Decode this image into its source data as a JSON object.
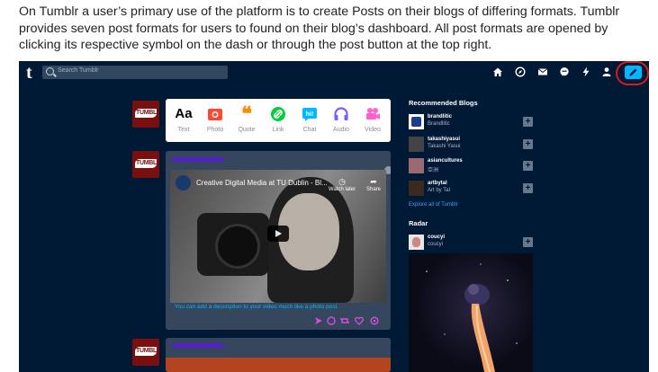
{
  "caption": "On Tumblr a user’s primary use of the platform is to create Posts on their blogs of differing formats. Tumblr provides seven post formats for users to found on their blog’s dashboard. All post formats are opened by clicking its respective symbol on the dash or through the post button at the top right.",
  "tumblr": {
    "logo": "t",
    "search_placeholder": "Search Tumblr",
    "nav_icons": [
      "home-icon",
      "explore-icon",
      "inbox-icon",
      "messages-icon",
      "activity-icon",
      "account-icon"
    ],
    "post_button_icon": "pencil-icon",
    "avatar_text": "TUMBLR",
    "post_formats": [
      {
        "label": "Text",
        "glyph": "Aa",
        "color": "#000000"
      },
      {
        "label": "Photo",
        "glyph": "◙",
        "color": "#ff492f"
      },
      {
        "label": "Quote",
        "glyph": "❝",
        "color": "#ff8a00"
      },
      {
        "label": "Link",
        "glyph": "🔗",
        "color": "#00cf35"
      },
      {
        "label": "Chat",
        "glyph": "hi!",
        "color": "#00b8ff"
      },
      {
        "label": "Audio",
        "glyph": "🎧",
        "color": "#7c5cff"
      },
      {
        "label": "Video",
        "glyph": "🎥",
        "color": "#ff62ce"
      }
    ],
    "video_post": {
      "video_title": "Creative Digital Media at TU Dublin - Bl...",
      "watch_later": "Watch later",
      "share": "Share",
      "description": "You can add a description to your video much like a photo post"
    },
    "recommended": {
      "title": "Recommended Blogs",
      "blogs": [
        {
          "name": "brandlitic",
          "sub": "Brandlitic",
          "color": "#1a3e8c"
        },
        {
          "name": "takashiyasui",
          "sub": "Takashi Yasui",
          "color": "#444444"
        },
        {
          "name": "asiancultures",
          "sub": "亞洲",
          "color": "#9a6a70"
        },
        {
          "name": "artbytal",
          "sub": "Art by Tal",
          "color": "#3a2a20"
        }
      ],
      "explore": "Explore all of Tumblr"
    },
    "radar": {
      "title": "Radar",
      "blog_name": "coucyi",
      "blog_sub": "coucyi"
    },
    "colors": {
      "background": "#001935",
      "accent": "#00b8ff",
      "card": "#36465d",
      "highlight": "#d81c1c"
    }
  }
}
